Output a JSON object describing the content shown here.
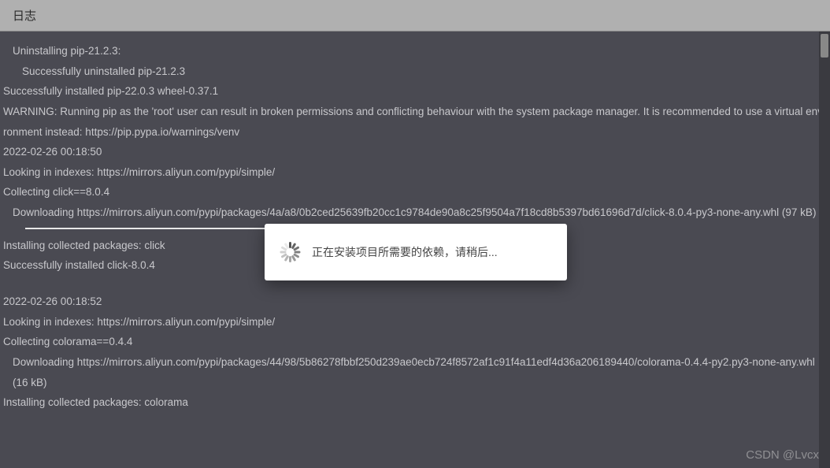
{
  "header": {
    "title": "日志"
  },
  "log": {
    "lines": [
      {
        "text": "Uninstalling pip-21.2.3:",
        "indent": 1
      },
      {
        "text": "Successfully uninstalled pip-21.2.3",
        "indent": 2
      },
      {
        "text": "Successfully installed pip-22.0.3 wheel-0.37.1",
        "indent": 0
      },
      {
        "text": "WARNING: Running pip as the 'root' user can result in broken permissions and conflicting behaviour with the system package manager. It is recommended to use a virtual environment instead: https://pip.pypa.io/warnings/venv",
        "indent": 0
      },
      {
        "text": "2022-02-26 00:18:50",
        "indent": 0
      },
      {
        "text": "Looking in indexes: https://mirrors.aliyun.com/pypi/simple/",
        "indent": 0
      },
      {
        "text": "Collecting click==8.0.4",
        "indent": 0
      },
      {
        "text": "Downloading https://mirrors.aliyun.com/pypi/packages/4a/a8/0b2ced25639fb20cc1c9784de90a8c25f9504a7f18cd8b5397bd61696d7d/click-8.0.4-py3-none-any.whl (97 kB)",
        "indent": 1,
        "progress": true
      },
      {
        "text": "Installing collected packages: click",
        "indent": 0
      },
      {
        "text": "Successfully installed click-8.0.4",
        "indent": 0
      },
      {
        "text": "",
        "indent": 0,
        "blank": true
      },
      {
        "text": "2022-02-26 00:18:52",
        "indent": 0
      },
      {
        "text": "Looking in indexes: https://mirrors.aliyun.com/pypi/simple/",
        "indent": 0
      },
      {
        "text": "Collecting colorama==0.4.4",
        "indent": 0
      },
      {
        "text": "Downloading https://mirrors.aliyun.com/pypi/packages/44/98/5b86278fbbf250d239ae0ecb724f8572af1c91f4a11edf4d36a206189440/colorama-0.4.4-py2.py3-none-any.whl (16 kB)",
        "indent": 1
      },
      {
        "text": "Installing collected packages: colorama",
        "indent": 0
      }
    ]
  },
  "modal": {
    "message": "正在安装项目所需要的依赖，请稍后..."
  },
  "watermark": {
    "text": "CSDN @Lvcx"
  }
}
